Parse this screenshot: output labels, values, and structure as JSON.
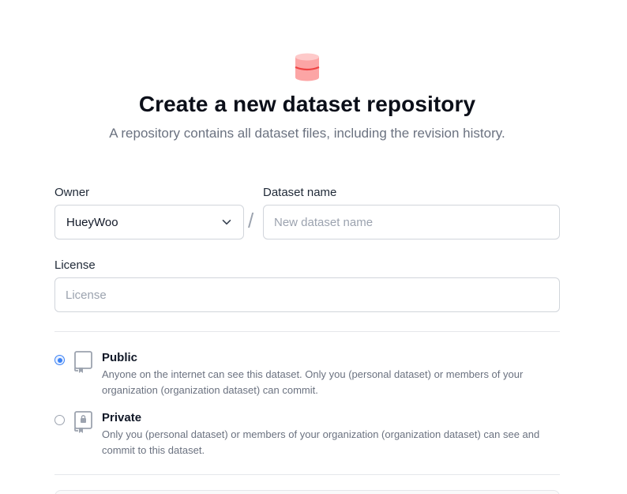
{
  "header": {
    "icon": "database-icon",
    "title": "Create a new dataset repository",
    "subtitle": "A repository contains all dataset files, including the revision history."
  },
  "form": {
    "owner": {
      "label": "Owner",
      "value": "HueyWoo"
    },
    "separator": "/",
    "dataset_name": {
      "label": "Dataset name",
      "placeholder": "New dataset name"
    },
    "license": {
      "label": "License",
      "placeholder": "License"
    }
  },
  "visibility": {
    "selected": "public",
    "public": {
      "title": "Public",
      "description": "Anyone on the internet can see this dataset. Only you (personal dataset) or members of your organization (organization dataset) can commit."
    },
    "private": {
      "title": "Private",
      "description": "Only you (personal dataset) or members of your organization (organization dataset) can see and commit to this dataset."
    }
  },
  "colors": {
    "accent": "#3b82f6",
    "icon_red": "#f87171",
    "icon_red_light": "#fca5a5"
  }
}
